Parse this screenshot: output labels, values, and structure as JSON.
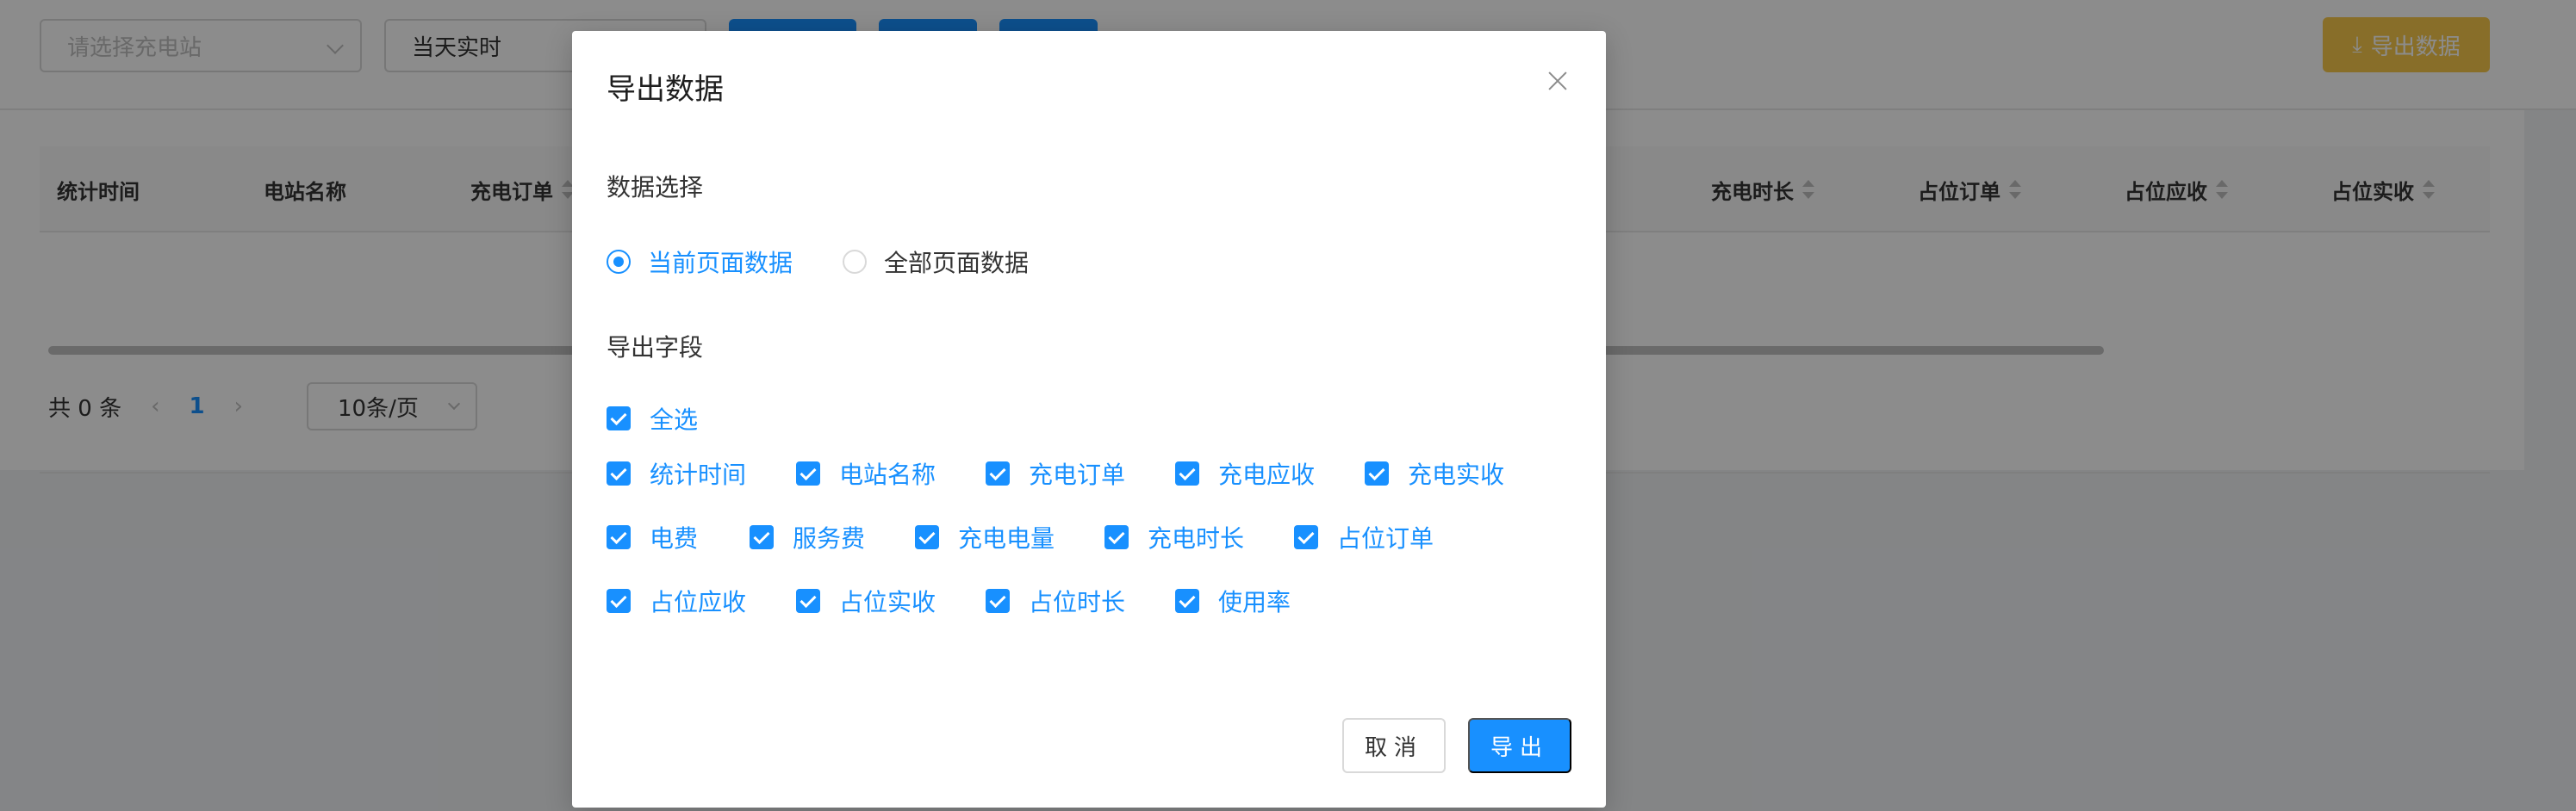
{
  "toolbar": {
    "station_placeholder": "请选择充电站",
    "time_value": "当天实时",
    "export_label": "导出数据",
    "export_icon": "download-icon"
  },
  "table": {
    "columns": [
      "统计时间",
      "电站名称",
      "充电订单",
      "充电时长",
      "占位订单",
      "占位应收",
      "占位实收"
    ]
  },
  "pagination": {
    "total": "共 0 条",
    "current_page": "1",
    "page_size": "10条/页"
  },
  "modal": {
    "title": "导出数据",
    "data_section_label": "数据选择",
    "radio_options": [
      {
        "label": "当前页面数据",
        "checked": true
      },
      {
        "label": "全部页面数据",
        "checked": false
      }
    ],
    "fields_section_label": "导出字段",
    "select_all_label": "全选",
    "fields": [
      "统计时间",
      "电站名称",
      "充电订单",
      "充电应收",
      "充电实收",
      "电费",
      "服务费",
      "充电电量",
      "充电时长",
      "占位订单",
      "占位应收",
      "占位实收",
      "占位时长",
      "使用率"
    ],
    "cancel_label": "取消",
    "ok_label": "导出"
  },
  "colors": {
    "primary": "#1890ff",
    "export_button": "#f7c94b"
  }
}
